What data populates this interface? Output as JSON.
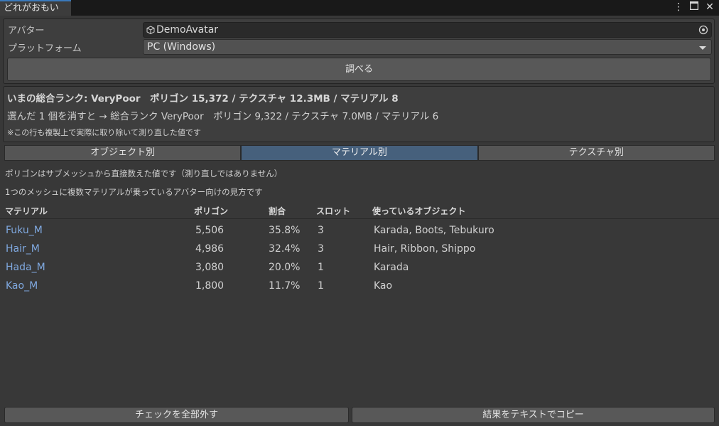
{
  "window": {
    "tab_title": "どれがおもい",
    "icons": [
      "more-vertical-icon",
      "maximize-icon",
      "close-icon"
    ]
  },
  "form": {
    "avatar_label": "アバター",
    "avatar_value": "DemoAvatar",
    "platform_label": "プラットフォーム",
    "platform_value": "PC (Windows)",
    "inspect_button": "調べる"
  },
  "summary": {
    "line1": "いまの総合ランク: VeryPoor　ポリゴン 15,372 / テクスチャ 12.3MB / マテリアル 8",
    "line2": "選んだ 1 個を消すと → 総合ランク VeryPoor　ポリゴン 9,322 / テクスチャ 7.0MB / マテリアル 6",
    "note": "※この行も複製上で実際に取り除いて測り直した値です"
  },
  "tabs": [
    {
      "label": "オブジェクト別",
      "active": false
    },
    {
      "label": "マテリアル別",
      "active": true
    },
    {
      "label": "テクスチャ別",
      "active": false
    }
  ],
  "info": {
    "line1": "ポリゴンはサブメッシュから直接数えた値です（測り直しではありません）",
    "line2": "1つのメッシュに複数マテリアルが乗っているアバター向けの見方です"
  },
  "table": {
    "headers": [
      "マテリアル",
      "ポリゴン",
      "割合",
      "スロット",
      "使っているオブジェクト"
    ],
    "rows": [
      {
        "material": "Fuku_M",
        "polygons": "5,506",
        "ratio": "35.8%",
        "slots": "3",
        "objects": "Karada, Boots, Tebukuro"
      },
      {
        "material": "Hair_M",
        "polygons": "4,986",
        "ratio": "32.4%",
        "slots": "3",
        "objects": "Hair, Ribbon, Shippo"
      },
      {
        "material": "Hada_M",
        "polygons": "3,080",
        "ratio": "20.0%",
        "slots": "1",
        "objects": "Karada"
      },
      {
        "material": "Kao_M",
        "polygons": "1,800",
        "ratio": "11.7%",
        "slots": "1",
        "objects": "Kao"
      }
    ]
  },
  "footer": {
    "uncheck_all_button": "チェックを全部外す",
    "copy_text_button": "結果をテキストでコピー"
  },
  "colors": {
    "background": "#383838",
    "accent_tab": "#46607c",
    "link": "#7fa8df"
  }
}
